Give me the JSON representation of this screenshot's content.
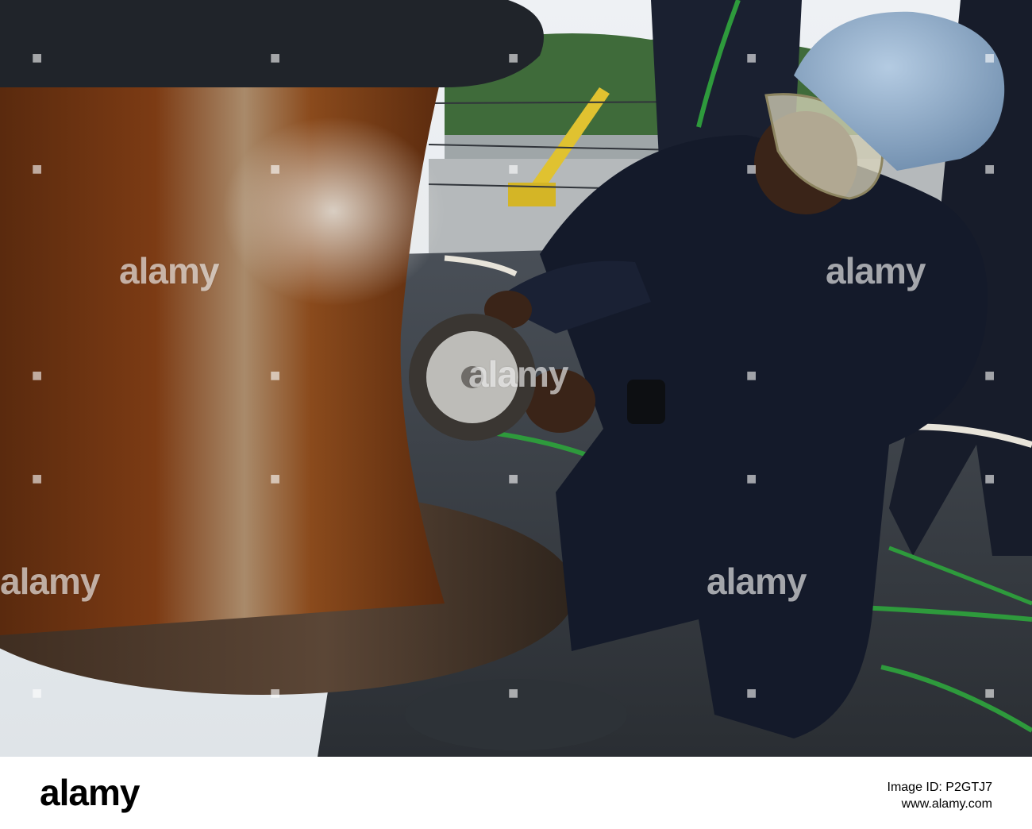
{
  "image": {
    "watermark_word": "alamy",
    "footer": {
      "logo": "alamy",
      "image_id_label": "Image ID: P2GTJ7",
      "site": "www.alamy.com"
    }
  },
  "colors": {
    "rust": "#7a3a12",
    "uniform": "#141a2a",
    "helmet": "#8aa6c4",
    "sky": "#e9edf1",
    "hose": "#2e9a3c"
  }
}
